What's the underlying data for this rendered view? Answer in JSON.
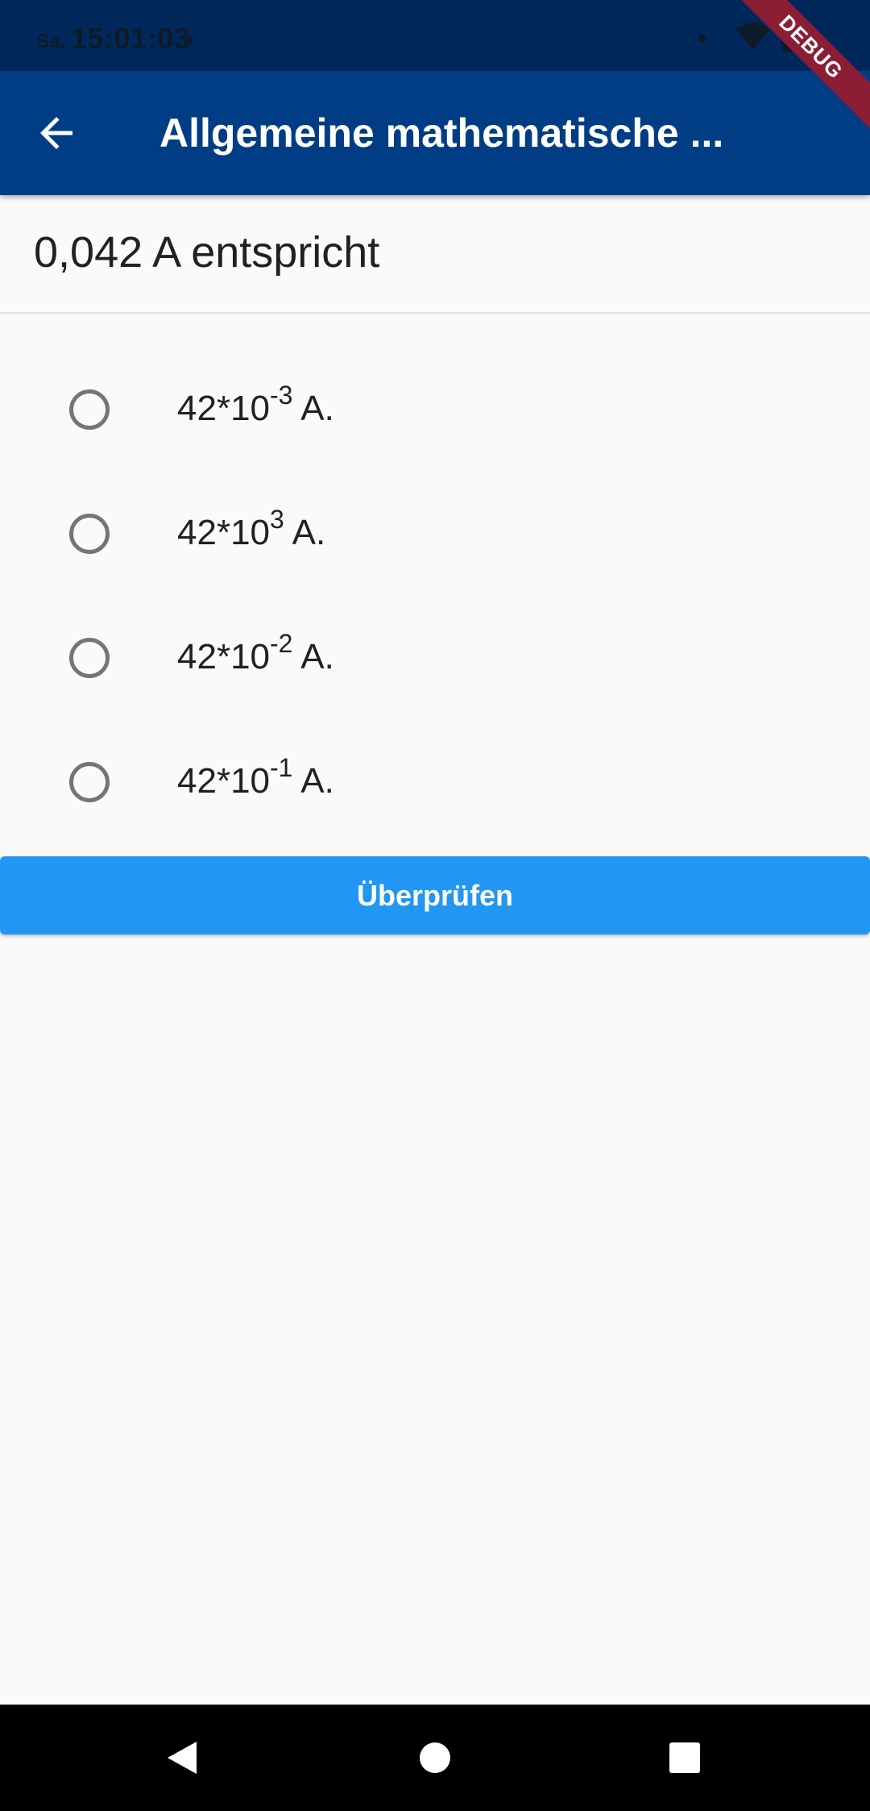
{
  "status_bar": {
    "day": "Sa.",
    "time": "15:01:03"
  },
  "debug_banner": "DEBUG",
  "app_bar": {
    "title": "Allgemeine mathematische ..."
  },
  "question": {
    "text": "0,042 A entspricht"
  },
  "options": [
    {
      "base": "42*10",
      "exponent": "-3",
      "unit": " A."
    },
    {
      "base": "42*10",
      "exponent": "3",
      "unit": " A."
    },
    {
      "base": "42*10",
      "exponent": "-2",
      "unit": " A."
    },
    {
      "base": "42*10",
      "exponent": "-1",
      "unit": " A."
    }
  ],
  "check_button": {
    "label": "Überprüfen"
  },
  "icons": {
    "back": "arrow-left-icon",
    "wifi": "wifi-icon",
    "battery": "battery-icon",
    "nav_back": "triangle-back-icon",
    "nav_home": "circle-home-icon",
    "nav_recents": "square-recents-icon"
  },
  "colors": {
    "app_bar": "#003d84",
    "status_bar": "#00285a",
    "button": "#2196f3",
    "debug": "#8b1d35"
  }
}
